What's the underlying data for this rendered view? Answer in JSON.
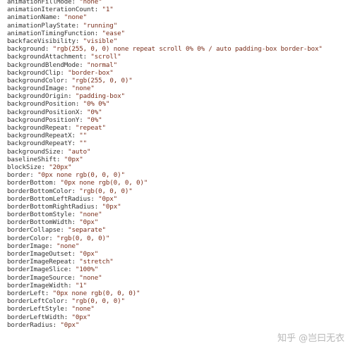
{
  "properties": [
    {
      "name": "animationFillMode",
      "value": "\"none\""
    },
    {
      "name": "animationIterationCount",
      "value": "\"1\""
    },
    {
      "name": "animationName",
      "value": "\"none\""
    },
    {
      "name": "animationPlayState",
      "value": "\"running\""
    },
    {
      "name": "animationTimingFunction",
      "value": "\"ease\""
    },
    {
      "name": "backfaceVisibility",
      "value": "\"visible\""
    },
    {
      "name": "background",
      "value": "\"rgb(255, 0, 0) none repeat scroll 0% 0% / auto padding-box border-box\""
    },
    {
      "name": "backgroundAttachment",
      "value": "\"scroll\""
    },
    {
      "name": "backgroundBlendMode",
      "value": "\"normal\""
    },
    {
      "name": "backgroundClip",
      "value": "\"border-box\""
    },
    {
      "name": "backgroundColor",
      "value": "\"rgb(255, 0, 0)\""
    },
    {
      "name": "backgroundImage",
      "value": "\"none\""
    },
    {
      "name": "backgroundOrigin",
      "value": "\"padding-box\""
    },
    {
      "name": "backgroundPosition",
      "value": "\"0% 0%\""
    },
    {
      "name": "backgroundPositionX",
      "value": "\"0%\""
    },
    {
      "name": "backgroundPositionY",
      "value": "\"0%\""
    },
    {
      "name": "backgroundRepeat",
      "value": "\"repeat\""
    },
    {
      "name": "backgroundRepeatX",
      "value": "\"\""
    },
    {
      "name": "backgroundRepeatY",
      "value": "\"\""
    },
    {
      "name": "backgroundSize",
      "value": "\"auto\""
    },
    {
      "name": "baselineShift",
      "value": "\"0px\""
    },
    {
      "name": "blockSize",
      "value": "\"20px\""
    },
    {
      "name": "border",
      "value": "\"0px none rgb(0, 0, 0)\""
    },
    {
      "name": "borderBottom",
      "value": "\"0px none rgb(0, 0, 0)\""
    },
    {
      "name": "borderBottomColor",
      "value": "\"rgb(0, 0, 0)\""
    },
    {
      "name": "borderBottomLeftRadius",
      "value": "\"0px\""
    },
    {
      "name": "borderBottomRightRadius",
      "value": "\"0px\""
    },
    {
      "name": "borderBottomStyle",
      "value": "\"none\""
    },
    {
      "name": "borderBottomWidth",
      "value": "\"0px\""
    },
    {
      "name": "borderCollapse",
      "value": "\"separate\""
    },
    {
      "name": "borderColor",
      "value": "\"rgb(0, 0, 0)\""
    },
    {
      "name": "borderImage",
      "value": "\"none\""
    },
    {
      "name": "borderImageOutset",
      "value": "\"0px\""
    },
    {
      "name": "borderImageRepeat",
      "value": "\"stretch\""
    },
    {
      "name": "borderImageSlice",
      "value": "\"100%\""
    },
    {
      "name": "borderImageSource",
      "value": "\"none\""
    },
    {
      "name": "borderImageWidth",
      "value": "\"1\""
    },
    {
      "name": "borderLeft",
      "value": "\"0px none rgb(0, 0, 0)\""
    },
    {
      "name": "borderLeftColor",
      "value": "\"rgb(0, 0, 0)\""
    },
    {
      "name": "borderLeftStyle",
      "value": "\"none\""
    },
    {
      "name": "borderLeftWidth",
      "value": "\"0px\""
    },
    {
      "name": "borderRadius",
      "value": "\"0px\""
    }
  ],
  "separator": ": ",
  "watermark": {
    "site": "知乎",
    "author": "@岂曰无衣"
  },
  "colors": {
    "background": "#ffffff",
    "text": "#333333",
    "value": "#7a2f1c",
    "watermark": "#b7b7b7"
  }
}
